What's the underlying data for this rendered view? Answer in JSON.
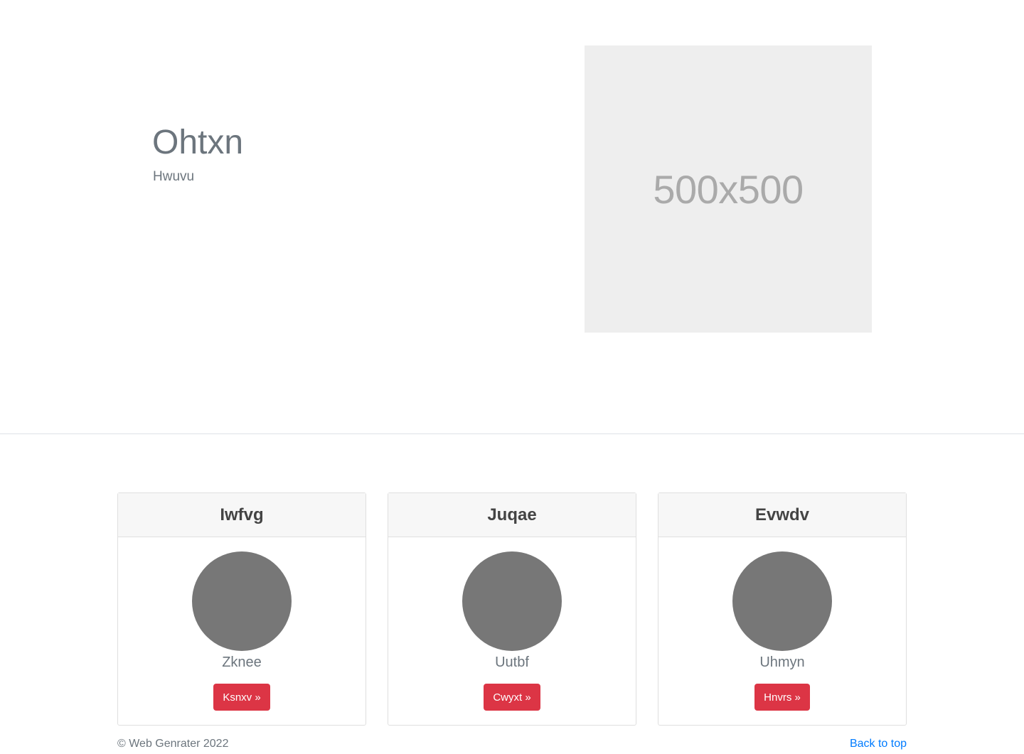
{
  "hero": {
    "title": "Ohtxn",
    "subtitle": "Hwuvu",
    "image_label": "500x500"
  },
  "cards": [
    {
      "title": "Iwfvg",
      "name": "Zknee",
      "button_label": "Ksnxv »"
    },
    {
      "title": "Juqae",
      "name": "Uutbf",
      "button_label": "Cwyxt »"
    },
    {
      "title": "Evwdv",
      "name": "Uhmyn",
      "button_label": "Hnvrs »"
    }
  ],
  "footer": {
    "copyright": "© Web Genrater 2022",
    "back_to_top": "Back to top"
  },
  "colors": {
    "button": "#dc3545",
    "link": "#007bff",
    "avatar": "#777777",
    "placeholder_bg": "#eeeeee"
  }
}
